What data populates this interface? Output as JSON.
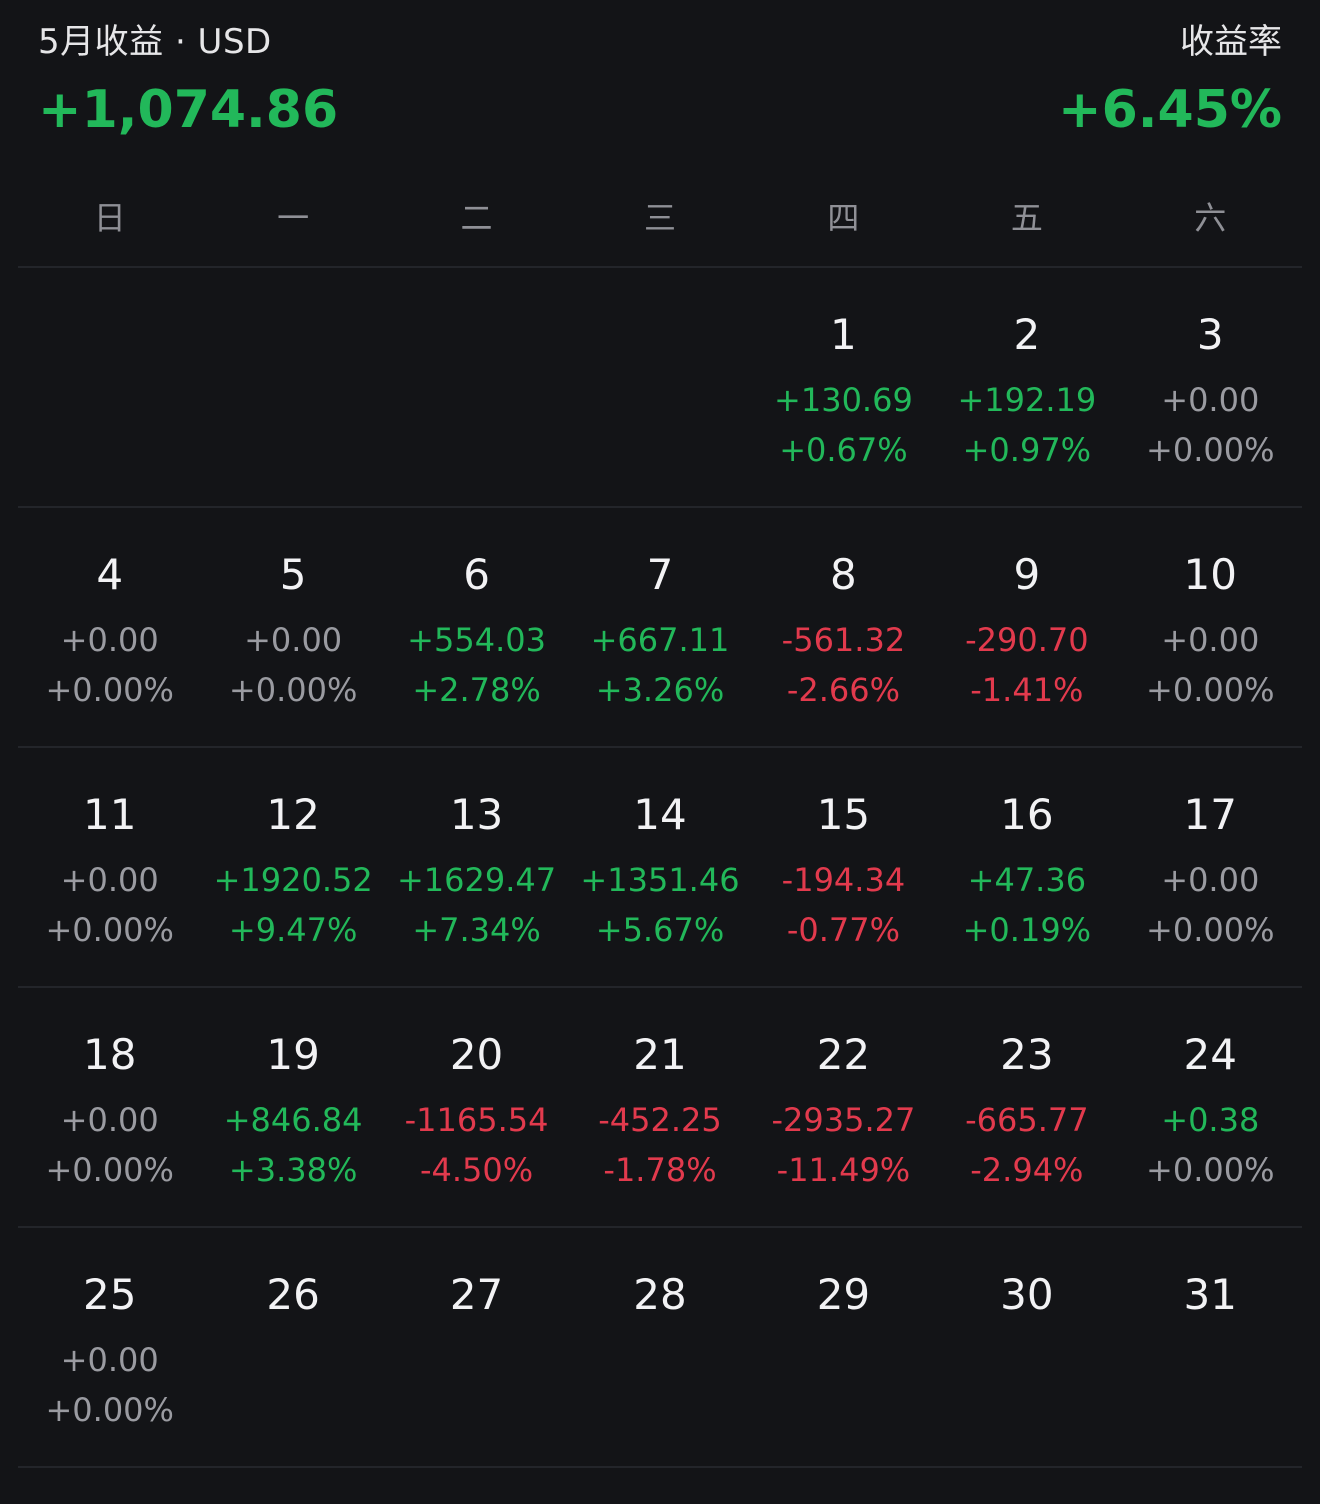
{
  "summary": {
    "title": "5月收益 · USD",
    "rate_label": "收益率",
    "total_profit": "+1,074.86",
    "total_rate": "+6.45%",
    "colors": {
      "positive": "#22b85a",
      "negative": "#e23a4d",
      "neutral": "#9a9ba1"
    }
  },
  "weekdays": [
    "日",
    "一",
    "二",
    "三",
    "四",
    "五",
    "六"
  ],
  "weeks": [
    [
      null,
      null,
      null,
      null,
      {
        "day": "1",
        "value": "+130.69",
        "pct": "+0.67%",
        "trend": "pos"
      },
      {
        "day": "2",
        "value": "+192.19",
        "pct": "+0.97%",
        "trend": "pos"
      },
      {
        "day": "3",
        "value": "+0.00",
        "pct": "+0.00%",
        "trend": "flat"
      }
    ],
    [
      {
        "day": "4",
        "value": "+0.00",
        "pct": "+0.00%",
        "trend": "flat"
      },
      {
        "day": "5",
        "value": "+0.00",
        "pct": "+0.00%",
        "trend": "flat"
      },
      {
        "day": "6",
        "value": "+554.03",
        "pct": "+2.78%",
        "trend": "pos"
      },
      {
        "day": "7",
        "value": "+667.11",
        "pct": "+3.26%",
        "trend": "pos"
      },
      {
        "day": "8",
        "value": "-561.32",
        "pct": "-2.66%",
        "trend": "neg"
      },
      {
        "day": "9",
        "value": "-290.70",
        "pct": "-1.41%",
        "trend": "neg"
      },
      {
        "day": "10",
        "value": "+0.00",
        "pct": "+0.00%",
        "trend": "flat"
      }
    ],
    [
      {
        "day": "11",
        "value": "+0.00",
        "pct": "+0.00%",
        "trend": "flat"
      },
      {
        "day": "12",
        "value": "+1920.52",
        "pct": "+9.47%",
        "trend": "pos"
      },
      {
        "day": "13",
        "value": "+1629.47",
        "pct": "+7.34%",
        "trend": "pos"
      },
      {
        "day": "14",
        "value": "+1351.46",
        "pct": "+5.67%",
        "trend": "pos"
      },
      {
        "day": "15",
        "value": "-194.34",
        "pct": "-0.77%",
        "trend": "neg"
      },
      {
        "day": "16",
        "value": "+47.36",
        "pct": "+0.19%",
        "trend": "pos"
      },
      {
        "day": "17",
        "value": "+0.00",
        "pct": "+0.00%",
        "trend": "flat"
      }
    ],
    [
      {
        "day": "18",
        "value": "+0.00",
        "pct": "+0.00%",
        "trend": "flat"
      },
      {
        "day": "19",
        "value": "+846.84",
        "pct": "+3.38%",
        "trend": "pos"
      },
      {
        "day": "20",
        "value": "-1165.54",
        "pct": "-4.50%",
        "trend": "neg"
      },
      {
        "day": "21",
        "value": "-452.25",
        "pct": "-1.78%",
        "trend": "neg"
      },
      {
        "day": "22",
        "value": "-2935.27",
        "pct": "-11.49%",
        "trend": "neg"
      },
      {
        "day": "23",
        "value": "-665.77",
        "pct": "-2.94%",
        "trend": "neg"
      },
      {
        "day": "24",
        "value": "+0.38",
        "pct": "+0.00%",
        "trend": "pos",
        "pct_trend": "flat"
      }
    ],
    [
      {
        "day": "25",
        "value": "+0.00",
        "pct": "+0.00%",
        "trend": "flat"
      },
      {
        "day": "26",
        "value": "",
        "pct": "",
        "trend": "flat"
      },
      {
        "day": "27",
        "value": "",
        "pct": "",
        "trend": "flat"
      },
      {
        "day": "28",
        "value": "",
        "pct": "",
        "trend": "flat"
      },
      {
        "day": "29",
        "value": "",
        "pct": "",
        "trend": "flat"
      },
      {
        "day": "30",
        "value": "",
        "pct": "",
        "trend": "flat"
      },
      {
        "day": "31",
        "value": "",
        "pct": "",
        "trend": "flat"
      }
    ]
  ]
}
